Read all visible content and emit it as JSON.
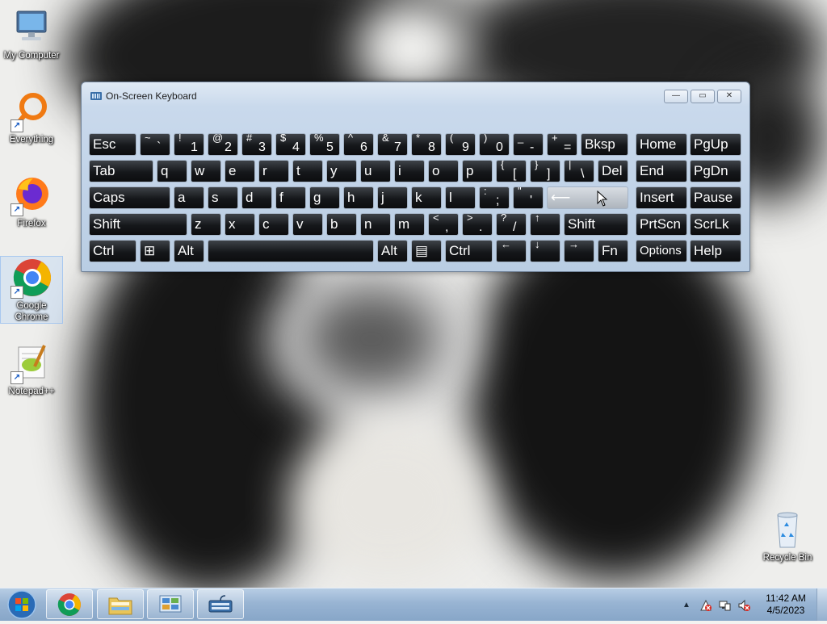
{
  "desktop": {
    "icons": [
      {
        "label": "My Computer",
        "icon": "computer-icon"
      },
      {
        "label": "Everything",
        "icon": "everything-icon"
      },
      {
        "label": "Firefox",
        "icon": "firefox-icon"
      },
      {
        "label": "Google Chrome",
        "icon": "chrome-icon"
      },
      {
        "label": "Notepad++",
        "icon": "notepadpp-icon"
      },
      {
        "label": "Recycle Bin",
        "icon": "recycle-bin-icon"
      }
    ]
  },
  "osk": {
    "title": "On-Screen Keyboard",
    "controls": {
      "minimize": "—",
      "restore": "▭",
      "close": "✕"
    },
    "rows": [
      [
        {
          "label": "Esc"
        },
        {
          "shift": "~",
          "main": "`"
        },
        {
          "shift": "!",
          "main": "1"
        },
        {
          "shift": "@",
          "main": "2"
        },
        {
          "shift": "#",
          "main": "3"
        },
        {
          "shift": "$",
          "main": "4"
        },
        {
          "shift": "%",
          "main": "5"
        },
        {
          "shift": "^",
          "main": "6"
        },
        {
          "shift": "&",
          "main": "7"
        },
        {
          "shift": "*",
          "main": "8"
        },
        {
          "shift": "(",
          "main": "9"
        },
        {
          "shift": ")",
          "main": "0"
        },
        {
          "shift": "_",
          "main": "-"
        },
        {
          "shift": "+",
          "main": "="
        },
        {
          "label": "Bksp"
        }
      ],
      [
        {
          "label": "Tab"
        },
        {
          "label": "q"
        },
        {
          "label": "w"
        },
        {
          "label": "e"
        },
        {
          "label": "r"
        },
        {
          "label": "t"
        },
        {
          "label": "y"
        },
        {
          "label": "u"
        },
        {
          "label": "i"
        },
        {
          "label": "o"
        },
        {
          "label": "p"
        },
        {
          "shift": "{",
          "main": "["
        },
        {
          "shift": "}",
          "main": "]"
        },
        {
          "shift": "|",
          "main": "\\"
        },
        {
          "label": "Del"
        }
      ],
      [
        {
          "label": "Caps"
        },
        {
          "label": "a"
        },
        {
          "label": "s"
        },
        {
          "label": "d"
        },
        {
          "label": "f"
        },
        {
          "label": "g"
        },
        {
          "label": "h"
        },
        {
          "label": "j"
        },
        {
          "label": "k"
        },
        {
          "label": "l"
        },
        {
          "shift": ":",
          "main": ";"
        },
        {
          "shift": "\"",
          "main": "'"
        },
        {
          "label": "⟵"
        }
      ],
      [
        {
          "label": "Shift"
        },
        {
          "label": "z"
        },
        {
          "label": "x"
        },
        {
          "label": "c"
        },
        {
          "label": "v"
        },
        {
          "label": "b"
        },
        {
          "label": "n"
        },
        {
          "label": "m"
        },
        {
          "shift": "<",
          "main": ","
        },
        {
          "shift": ">",
          "main": "."
        },
        {
          "shift": "?",
          "main": "/"
        },
        {
          "shift": "↑",
          "main": ""
        },
        {
          "label": "Shift"
        }
      ],
      [
        {
          "label": "Ctrl"
        },
        {
          "label": "⊞"
        },
        {
          "label": "Alt"
        },
        {
          "label": ""
        },
        {
          "label": "Alt"
        },
        {
          "label": "▤"
        },
        {
          "label": "Ctrl"
        },
        {
          "shift": "←",
          "main": ""
        },
        {
          "shift": "↓",
          "main": ""
        },
        {
          "shift": "→",
          "main": ""
        },
        {
          "label": "Fn"
        }
      ]
    ],
    "nav_keys": [
      [
        "Home",
        "PgUp"
      ],
      [
        "End",
        "PgDn"
      ],
      [
        "Insert",
        "Pause"
      ],
      [
        "PrtScn",
        "ScrLk"
      ],
      [
        "Options",
        "Help"
      ]
    ]
  },
  "taskbar": {
    "buttons": [
      {
        "name": "chrome",
        "icon": "chrome-icon"
      },
      {
        "name": "explorer",
        "icon": "folder-icon"
      },
      {
        "name": "control-panel",
        "icon": "control-panel-icon"
      },
      {
        "name": "on-screen-keyboard",
        "icon": "keyboard-icon"
      }
    ],
    "tray": {
      "show_hidden": "▲",
      "icons": [
        "action-center-icon",
        "network-icon",
        "volume-muted-icon"
      ]
    },
    "clock": {
      "time": "11:42 AM",
      "date": "4/5/2023"
    }
  },
  "colors": {
    "key_bg": "#15171a",
    "window_frame": "#c9d9ec",
    "taskbar": "#98b4d3"
  }
}
